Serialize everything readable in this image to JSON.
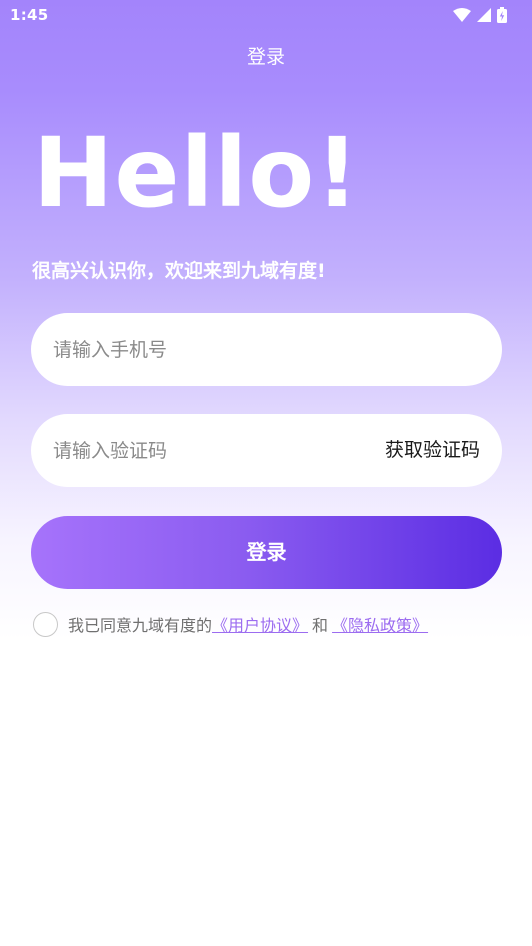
{
  "status_bar": {
    "time": "1:45",
    "icons": [
      "wifi-icon",
      "cellular-signal-icon",
      "battery-charging-icon"
    ]
  },
  "nav": {
    "title": "登录"
  },
  "hero": {
    "greeting": "Hello!",
    "welcome": "很高兴认识你，欢迎来到九域有度!"
  },
  "form": {
    "phone_placeholder": "请输入手机号",
    "phone_value": "",
    "code_placeholder": "请输入验证码",
    "code_value": "",
    "get_code_label": "获取验证码",
    "login_label": "登录"
  },
  "agreement": {
    "prefix": "我已同意九域有度的",
    "user_agreement": " 《用户协议》",
    "and": "和",
    "privacy_policy": " 《隐私政策》",
    "checked": false
  },
  "colors": {
    "gradient_top": "#a384fb",
    "button_start": "#a673fb",
    "button_end": "#5b2de3",
    "link": "#9c6cf0"
  }
}
